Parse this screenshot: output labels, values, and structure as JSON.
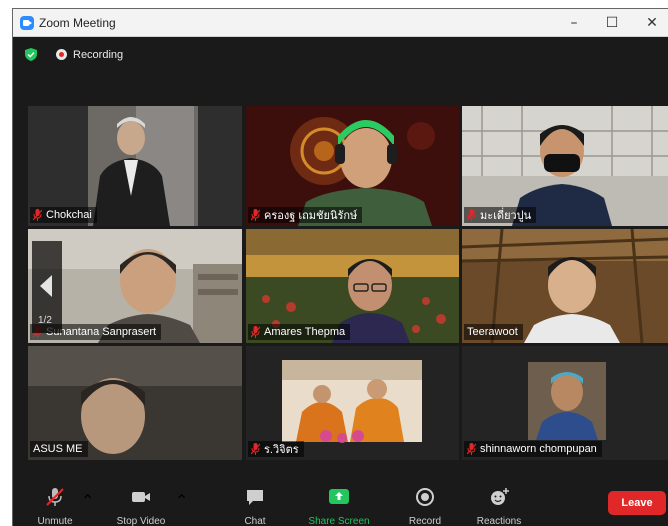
{
  "window": {
    "title": "Zoom Meeting"
  },
  "status": {
    "recording_label": "Recording"
  },
  "pager": {
    "page": "1/2"
  },
  "participants": [
    {
      "name": "Chokchai",
      "bg": "#3a3a3a"
    },
    {
      "name": "ครองฐ เถมชัยนิรักษ์",
      "bg": "#4a1410"
    },
    {
      "name": "มะเดี่ยวปูน",
      "bg": "#c9c7c0"
    },
    {
      "name": "Sunantana Sanprasert",
      "bg": "#b9b3a6"
    },
    {
      "name": "Amares Thepma",
      "bg": "#5a4a25"
    },
    {
      "name": "Teerawoot",
      "bg": "#6b4a2a"
    },
    {
      "name": "ASUS ME",
      "bg": "#3b3b3b"
    },
    {
      "name": "ร.วิจิตร",
      "bg": "#6e5a4a"
    },
    {
      "name": "shinnaworn chompupan",
      "bg": "#2a2a2a"
    }
  ],
  "toolbar": {
    "unmute": "Unmute",
    "stop_video": "Stop Video",
    "chat": "Chat",
    "share_screen": "Share Screen",
    "record": "Record",
    "reactions": "Reactions",
    "leave": "Leave"
  },
  "colors": {
    "share_accent": "#22c55e",
    "leave_red": "#e02828",
    "active_speaker": "#c9d84a"
  }
}
